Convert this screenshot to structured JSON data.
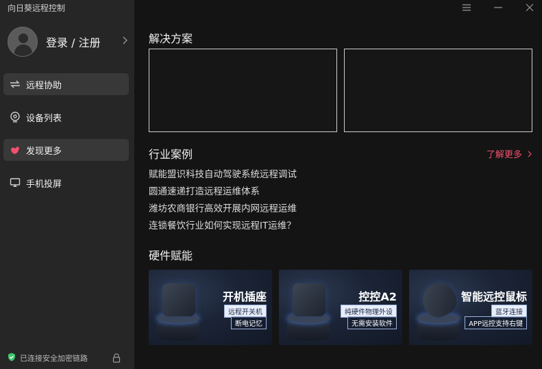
{
  "app": {
    "title": "向日葵远程控制"
  },
  "user": {
    "login_label": "登录 / 注册"
  },
  "nav": {
    "items": [
      {
        "label": "远程协助",
        "icon": "remote-assist-icon",
        "active": true
      },
      {
        "label": "设备列表",
        "icon": "device-list-icon",
        "active": false
      },
      {
        "label": "发现更多",
        "icon": "discover-icon",
        "active": true
      },
      {
        "label": "手机投屏",
        "icon": "screen-cast-icon",
        "active": false
      }
    ]
  },
  "status": {
    "text": "已连接安全加密链路"
  },
  "solutions": {
    "title": "解决方案"
  },
  "cases": {
    "title": "行业案例",
    "more": "了解更多",
    "items": [
      "赋能盟识科技自动驾驶系统远程调试",
      "圆通速递打造远程运维体系",
      "潍坊农商银行高效开展内网远程运维",
      "连锁餐饮行业如何实现远程IT运维？"
    ]
  },
  "hardware": {
    "title": "硬件赋能",
    "cards": [
      {
        "title": "开机插座",
        "tag1": "远程开关机",
        "tag2": "断电记忆"
      },
      {
        "title": "控控A2",
        "tag1": "纯硬件物理外设",
        "tag2": "无需安装软件"
      },
      {
        "title": "智能远控鼠标",
        "tag1": "蓝牙连接",
        "tag2": "APP远控支持右键"
      }
    ]
  },
  "colors": {
    "accent": "#f0506e",
    "sidebar": "#262626",
    "background": "#141414",
    "status_ok": "#3ec46d"
  }
}
